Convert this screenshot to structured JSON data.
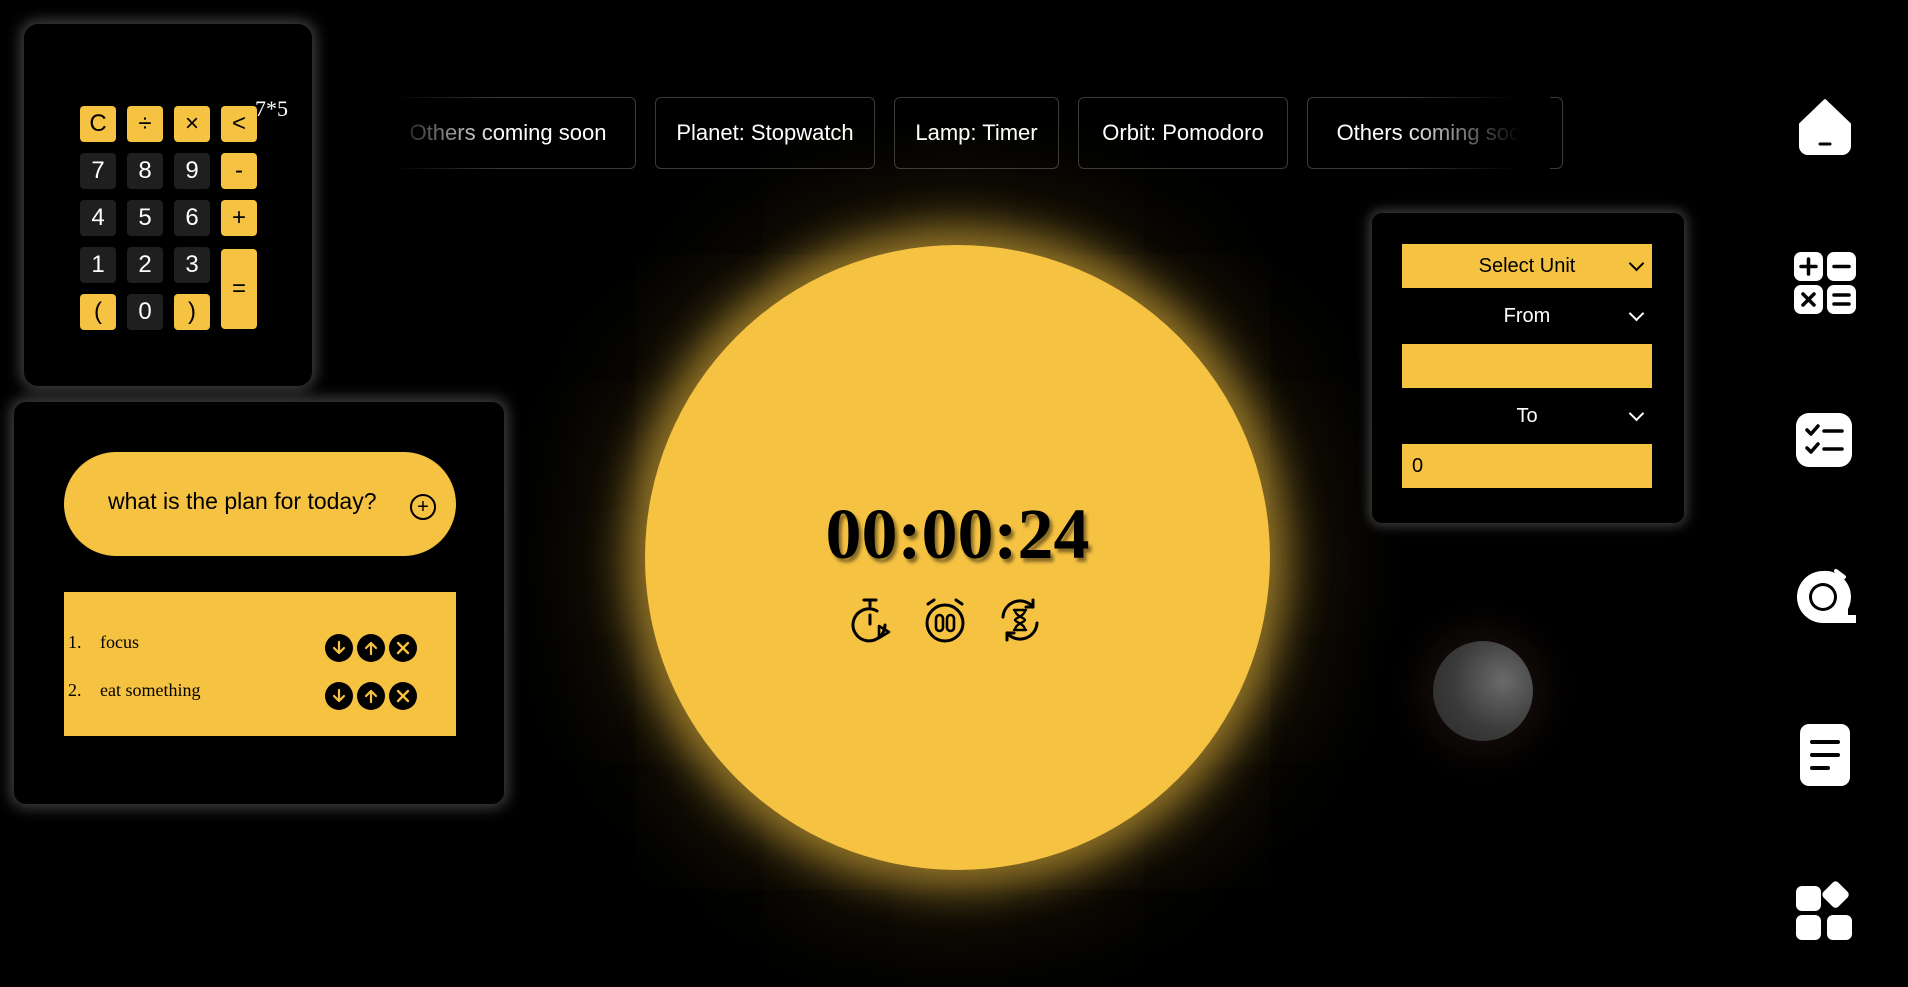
{
  "calculator": {
    "display": "7*5",
    "keys": {
      "clear": "C",
      "divide": "÷",
      "multiply": "×",
      "backspace": "<",
      "seven": "7",
      "eight": "8",
      "nine": "9",
      "minus": "-",
      "four": "4",
      "five": "5",
      "six": "6",
      "plus": "+",
      "one": "1",
      "two": "2",
      "three": "3",
      "equals": "=",
      "open_paren": "(",
      "zero": "0",
      "close_paren": ")"
    }
  },
  "todo": {
    "input_placeholder": "what is the plan for today?",
    "add_symbol": "+",
    "items": [
      {
        "number": "1.",
        "text": "focus"
      },
      {
        "number": "2.",
        "text": "eat something"
      }
    ]
  },
  "nav": {
    "pills": [
      "Others coming soon",
      "Planet: Stopwatch",
      "Lamp: Timer",
      "Orbit: Pomodoro",
      "Others coming soon"
    ]
  },
  "stopwatch": {
    "time": "00:00:24",
    "buttons": [
      "start-icon",
      "pause-icon",
      "reset-icon"
    ]
  },
  "converter": {
    "unit_select": "Select Unit",
    "from_select": "From",
    "from_value": "",
    "to_select": "To",
    "result": "0"
  },
  "sidebar": {
    "icons": [
      "home-icon",
      "calculator-icon",
      "checklist-icon",
      "tape-measure-icon",
      "notes-icon",
      "apps-icon"
    ]
  },
  "colors": {
    "accent": "#f5c242",
    "background": "#000000",
    "key_dark": "#1f1f1f"
  }
}
